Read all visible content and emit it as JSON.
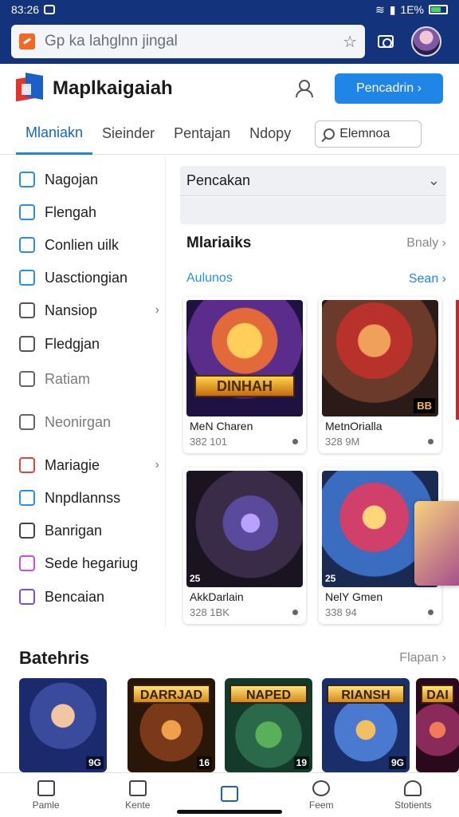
{
  "status_bar": {
    "time": "83:26",
    "battery": "1E%"
  },
  "browser": {
    "url": "Gp ka lahglnn jingal"
  },
  "app": {
    "title": "Maplkaigaiah",
    "primary_button": "Pencadrin ›"
  },
  "tabs": [
    {
      "label": "Mlaniakn",
      "active": true
    },
    {
      "label": "Sieinder",
      "active": false
    },
    {
      "label": "Pentajan",
      "active": false
    },
    {
      "label": "Ndopy",
      "active": false
    }
  ],
  "tab_search_label": "Elemnoa",
  "sidebar": {
    "items": [
      {
        "label": "Nagojan",
        "icon": "calendar-icon",
        "color": "#2a8ee8",
        "muted": false
      },
      {
        "label": "Flengah",
        "icon": "pen-icon",
        "color": "#2a8ee8",
        "muted": false
      },
      {
        "label": "Conlien uilk",
        "icon": "folder-icon",
        "color": "#2a8ee8",
        "muted": false
      },
      {
        "label": "Uasctiongian",
        "icon": "cloud-icon",
        "color": "#2a8ee8",
        "muted": false
      },
      {
        "label": "Nansiop",
        "icon": "brush-icon",
        "color": "#555555",
        "muted": false,
        "chevron": "›"
      },
      {
        "label": "Fledgjan",
        "icon": "search-icon",
        "color": "#555555",
        "muted": false
      },
      {
        "label": "Ratiam",
        "icon": "list-icon",
        "color": "#666666",
        "muted": true
      },
      {
        "label": "Neonirgan",
        "icon": "document-icon",
        "color": "#666666",
        "muted": true
      },
      {
        "label": "Mariagie",
        "icon": "close-box-icon",
        "color": "#e0443a",
        "muted": false,
        "chevron": "›"
      },
      {
        "label": "Nnpdlannss",
        "icon": "refresh-icon",
        "color": "#2a8ee8",
        "muted": false
      },
      {
        "label": "Banrigan",
        "icon": "camera-icon",
        "color": "#444444",
        "muted": false
      },
      {
        "label": "Sede hegariug",
        "icon": "heart-icon",
        "color": "#c94fd6",
        "muted": false
      },
      {
        "label": "Bencaian",
        "icon": "tools-icon",
        "color": "#7a4fd6",
        "muted": false
      }
    ]
  },
  "main": {
    "select_value": "Pencakan",
    "section_title": "Mlariaiks",
    "section_link": "Bnaly ›",
    "sub_title": "Aulunos",
    "sub_link": "Sean ›",
    "cards": [
      {
        "title": "MeN Charen",
        "meta": "382 101",
        "banner": "DINHAH",
        "badge": ""
      },
      {
        "title": "MetnOrialla",
        "meta": "328 9M",
        "banner": "",
        "badge": "BB"
      },
      {
        "title": "AkkDarlain",
        "meta": "328 1BK",
        "banner": "",
        "badge": "25"
      },
      {
        "title": "NelY Gmen",
        "meta": "338 94",
        "banner": "",
        "badge": "25"
      }
    ]
  },
  "bottom": {
    "title": "Batehris",
    "link": "Flapan ›",
    "thumbs": [
      {
        "banner": "",
        "label": "9G"
      },
      {
        "banner": "DARRJAD",
        "label": "16"
      },
      {
        "banner": "NAPED",
        "label": "19"
      },
      {
        "banner": "RIANSH",
        "label": "9G"
      },
      {
        "banner": "DAI",
        "label": ""
      }
    ]
  },
  "nav": [
    {
      "label": "Pamle",
      "icon": "home-icon",
      "active": false
    },
    {
      "label": "Kente",
      "icon": "list-icon",
      "active": false
    },
    {
      "label": "",
      "icon": "bag-icon",
      "active": true
    },
    {
      "label": "Feem",
      "icon": "help-icon",
      "active": false
    },
    {
      "label": "Stotients",
      "icon": "user-icon",
      "active": false
    }
  ],
  "colors": {
    "accent": "#1f86e8",
    "header_bg": "#13347d"
  }
}
